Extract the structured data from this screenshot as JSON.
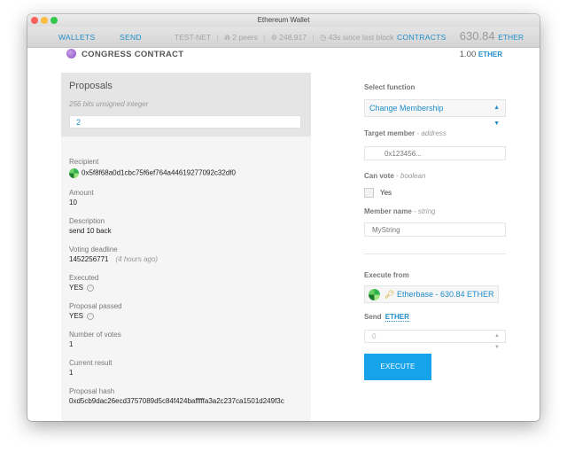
{
  "window": {
    "title": "Ethereum Wallet"
  },
  "nav": {
    "wallets": "WALLETS",
    "send": "SEND",
    "network": "TEST-NET",
    "peers": "2 peers",
    "block": "248,917",
    "last_block": "43s since last block",
    "contracts": "CONTRACTS",
    "balance": "630.84",
    "balance_unit": "ETHER"
  },
  "contract": {
    "title": "CONGRESS CONTRACT",
    "balance": "1.00",
    "balance_unit": "ETHER"
  },
  "proposals": {
    "title": "Proposals",
    "subtitle": "256 bits unsigned integer",
    "value": "2",
    "fields": {
      "recipient_label": "Recipient",
      "recipient_value": "0x5f8f68a0d1cbc75f6ef764a44619277092c32df0",
      "amount_label": "Amount",
      "amount_value": "10",
      "description_label": "Description",
      "description_value": "send 10 back",
      "deadline_label": "Voting deadline",
      "deadline_value": "1452256771",
      "deadline_relative": "(4 hours ago)",
      "executed_label": "Executed",
      "executed_value": "YES",
      "passed_label": "Proposal passed",
      "passed_value": "YES",
      "votes_label": "Number of votes",
      "votes_value": "1",
      "result_label": "Current result",
      "result_value": "1",
      "hash_label": "Proposal hash",
      "hash_value": "0xd5cb9dac26ecd3757089d5c84f424bafffffa3a2c237ca1501d249f3c"
    }
  },
  "execute_panel": {
    "select_label": "Select function",
    "selected_function": "Change Membership",
    "target_label": "Target member",
    "target_type": "- address",
    "target_placeholder": "0x123456...",
    "canvote_label": "Can vote",
    "canvote_type": "- boolean",
    "canvote_option": "Yes",
    "membername_label": "Member name",
    "membername_type": "- string",
    "membername_placeholder": "MyString",
    "execute_from_label": "Execute from",
    "account": "Etherbase - 630.84 ETHER",
    "send_label": "Send",
    "send_unit": "ETHER",
    "send_value": "0",
    "execute_button": "EXECUTE"
  },
  "colors": {
    "accent": "#1f8ec9",
    "button": "#17a3ea",
    "panel": "#f5f5f5"
  }
}
